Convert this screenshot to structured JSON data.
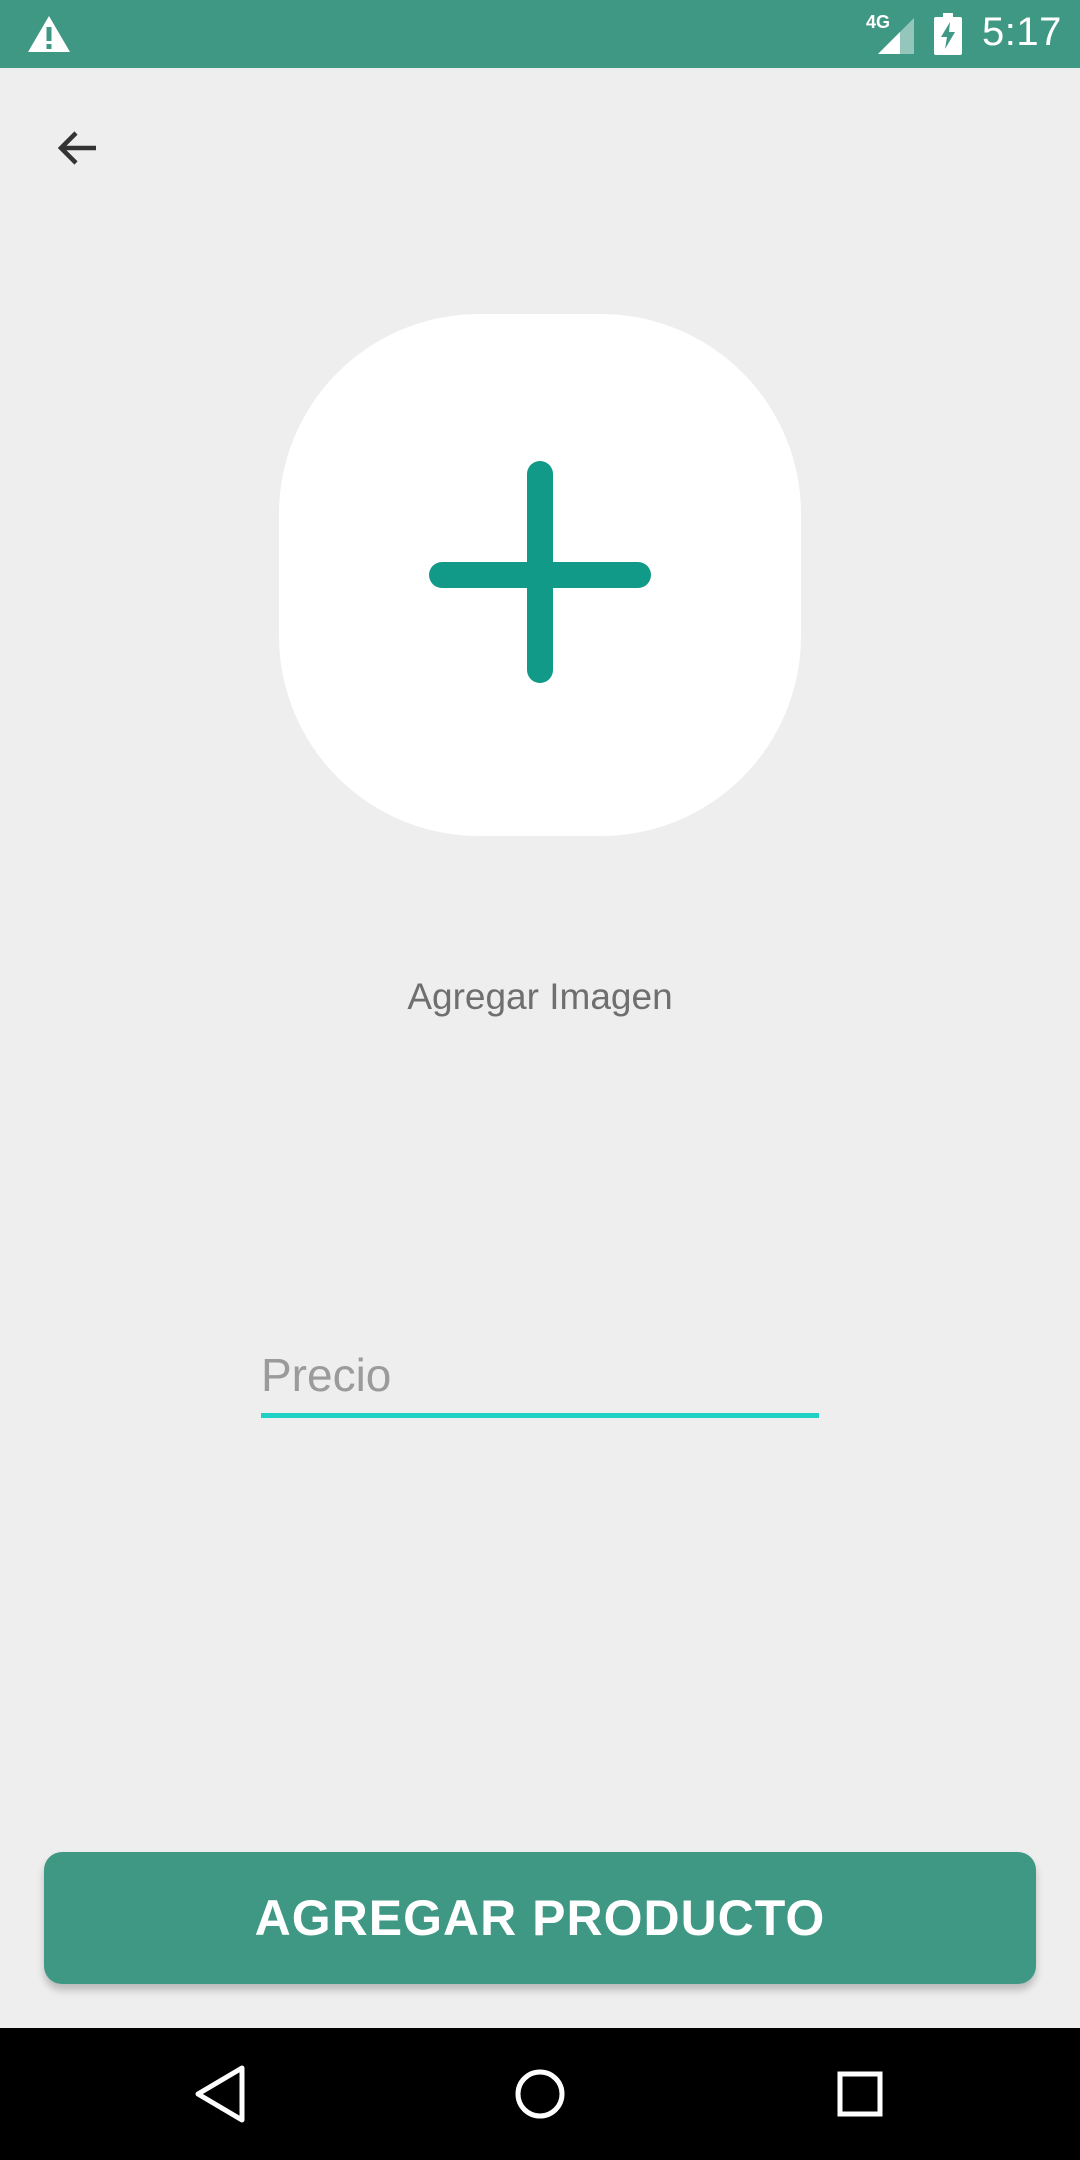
{
  "status_bar": {
    "network_label": "4G",
    "time": "5:17",
    "icons": [
      "warning-icon",
      "signal-icon",
      "battery-charging-icon"
    ]
  },
  "toolbar": {
    "back_icon": "arrow-back-icon"
  },
  "image_picker": {
    "icon": "plus-icon",
    "caption": "Agregar Imagen"
  },
  "form": {
    "price_placeholder": "Precio",
    "price_value": ""
  },
  "actions": {
    "add_product_label": "AGREGAR PRODUCTO"
  },
  "nav": {
    "icons": [
      "back-triangle-icon",
      "home-circle-icon",
      "recents-square-icon"
    ]
  },
  "colors": {
    "primary": "#3f9884",
    "accent": "#1fd1c4",
    "plus": "#129a88",
    "background": "#eeeeee"
  }
}
